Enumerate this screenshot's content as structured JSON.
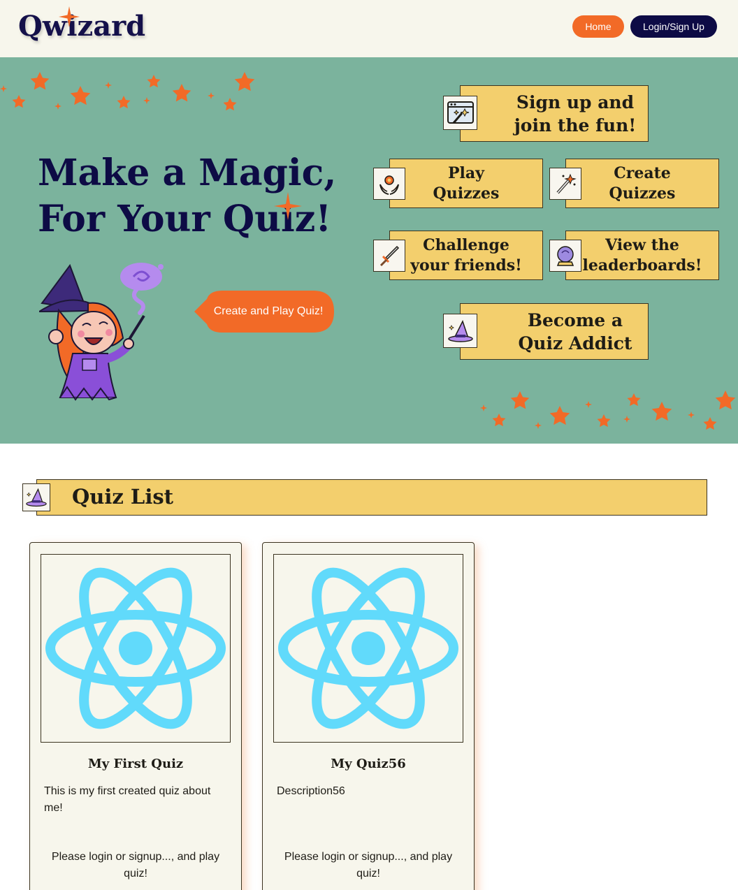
{
  "header": {
    "logo": "Qwizard",
    "nav": {
      "home": "Home",
      "login": "Login/Sign Up"
    }
  },
  "hero": {
    "title_line1": "Make a Magic,",
    "title_line2": "For Your Quiz!",
    "cta": "Create and Play Quiz!",
    "features": [
      {
        "line1": "Sign up and",
        "line2": "join the fun!",
        "icon": "magic-window-icon"
      },
      {
        "line1": "Play",
        "line2": "Quizzes",
        "icon": "hands-flower-icon"
      },
      {
        "line1": "Create",
        "line2": "Quizzes",
        "icon": "magic-wand-icon"
      },
      {
        "line1": "Challenge",
        "line2": "your friends!",
        "icon": "sword-icon"
      },
      {
        "line1": "View the",
        "line2": "leaderboards!",
        "icon": "crystal-ball-icon"
      },
      {
        "line1": "Become a",
        "line2": "Quiz Addict",
        "icon": "wizard-hat-icon"
      }
    ]
  },
  "quiz_list": {
    "title": "Quiz List",
    "icon": "wizard-hat-icon",
    "cards": [
      {
        "title": "My First Quiz",
        "description": "This is my first created quiz about me!",
        "note": "Please login or signup..., and play quiz!",
        "image": "react-logo-icon"
      },
      {
        "title": "My Quiz56",
        "description": "Description56",
        "note": "Please login or signup..., and play quiz!",
        "image": "react-logo-icon"
      }
    ]
  },
  "colors": {
    "header_bg": "#f7f6ec",
    "hero_bg": "#7bb39d",
    "accent_orange": "#f26a27",
    "navy": "#0d0b45",
    "card_yellow": "#f3cf6d",
    "react_blue": "#61dafb"
  }
}
